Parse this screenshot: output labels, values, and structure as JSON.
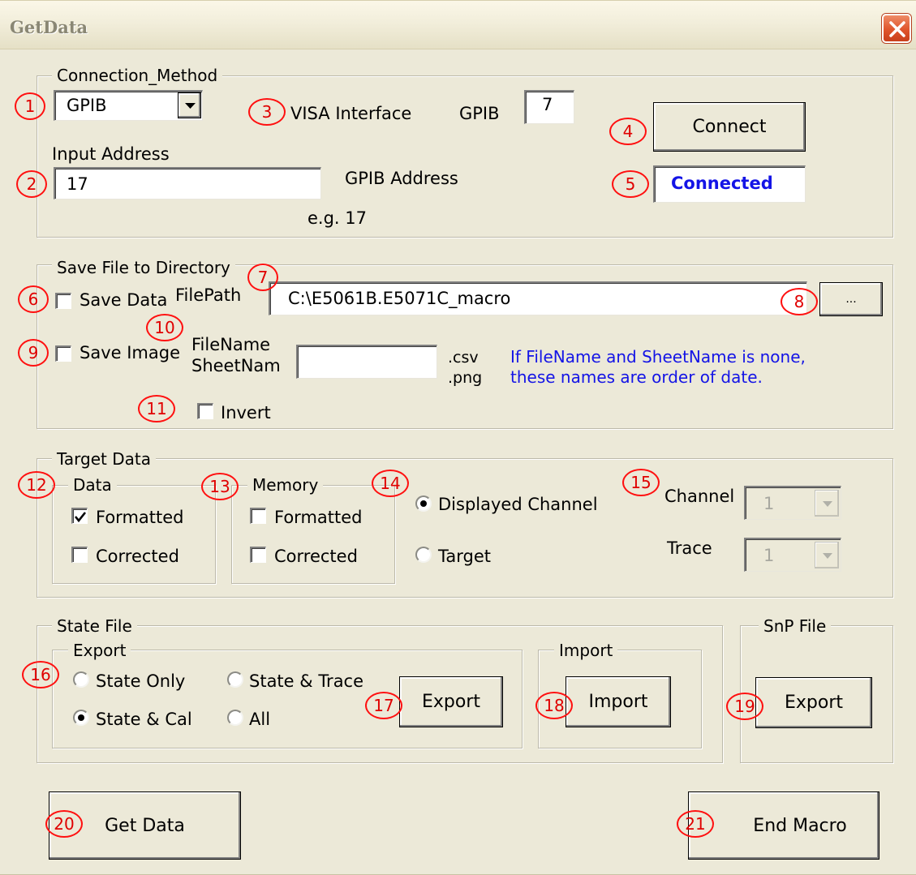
{
  "window": {
    "title": "GetData"
  },
  "connection": {
    "legend": "Connection_Method",
    "method_value": "GPIB",
    "visa_label": "VISA Interface",
    "gpib_label": "GPIB",
    "gpib_value": "7",
    "input_address_label": "Input Address",
    "address_value": "17",
    "gpib_address_label": "GPIB Address",
    "example": "e.g. 17",
    "connect_button": "Connect",
    "status": "Connected"
  },
  "save": {
    "legend": "Save File to Directory",
    "save_data": "Save Data",
    "filepath_label": "FilePath",
    "filepath_value": "C:\\E5061B.E5071C_macro",
    "browse_button": "...",
    "save_image": "Save Image",
    "filename_label": "FileName",
    "sheetname_label": "SheetNam",
    "filename_value": "",
    "csv_ext": ".csv",
    "png_ext": ".png",
    "hint_line1": "If FileName and SheetName is none,",
    "hint_line2": "these names are order of date.",
    "invert": "Invert"
  },
  "target": {
    "legend": "Target Data",
    "data_legend": "Data",
    "data_formatted": "Formatted",
    "data_corrected": "Corrected",
    "memory_legend": "Memory",
    "mem_formatted": "Formatted",
    "mem_corrected": "Corrected",
    "displayed_channel": "Displayed Channel",
    "target_option": "Target",
    "channel_label": "Channel",
    "channel_value": "1",
    "trace_label": "Trace",
    "trace_value": "1"
  },
  "state": {
    "legend": "State File",
    "export_legend": "Export",
    "state_only": "State Only",
    "state_trace": "State & Trace",
    "state_cal": "State & Cal",
    "all": "All",
    "export_button": "Export",
    "import_legend": "Import",
    "import_button": "Import"
  },
  "snp": {
    "legend": "SnP File",
    "export_button": "Export"
  },
  "actions": {
    "get_data": "Get Data",
    "end_macro": "End Macro"
  },
  "callouts": [
    "1",
    "2",
    "3",
    "4",
    "5",
    "6",
    "7",
    "8",
    "9",
    "10",
    "11",
    "12",
    "13",
    "14",
    "15",
    "16",
    "17",
    "18",
    "19",
    "20",
    "21"
  ],
  "colors": {
    "callout": "#ff1010",
    "status": "#1414e6",
    "hint": "#1414e6"
  }
}
